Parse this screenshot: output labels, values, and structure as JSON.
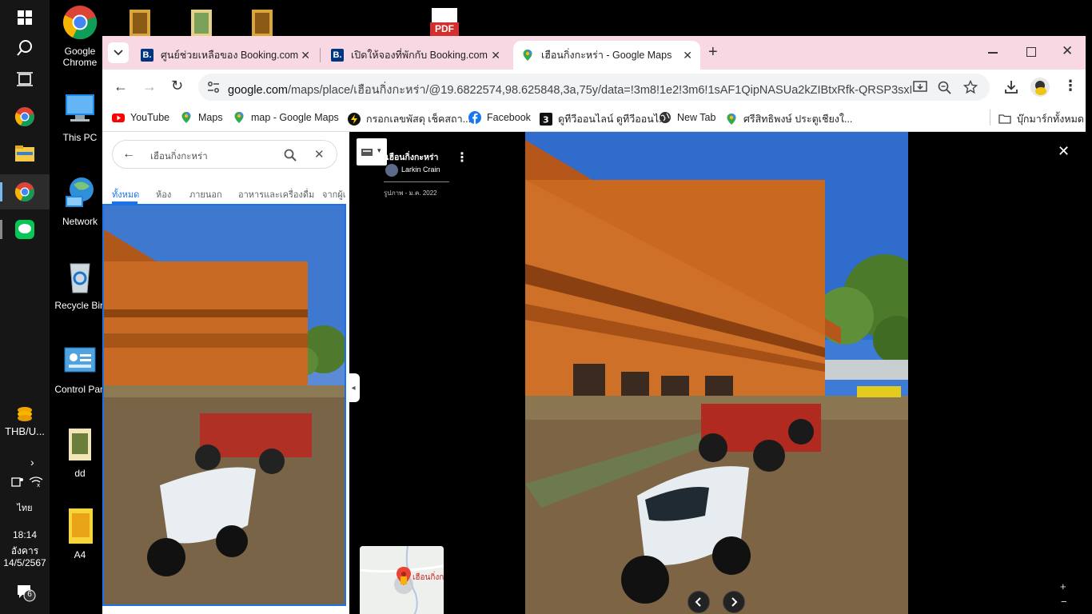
{
  "taskbar": {
    "currency_label": "THB/U...",
    "language": "ไทย",
    "time": "18:14",
    "day": "อังคาร",
    "date": "14/5/2567",
    "notification_count": "6"
  },
  "desktop": {
    "icons": [
      {
        "label": "Google Chrome"
      },
      {
        "label": "This PC"
      },
      {
        "label": "Network"
      },
      {
        "label": "Recycle Bin"
      },
      {
        "label": "Control Pan"
      },
      {
        "label": "dd"
      },
      {
        "label": "A4"
      }
    ],
    "pdf_label": "PDF"
  },
  "browser": {
    "tabs": [
      {
        "title": "ศูนย์ช่วยเหลือของ Booking.com",
        "favicon": "B."
      },
      {
        "title": "เปิดให้จองที่พักกับ Booking.com",
        "favicon": "B."
      },
      {
        "title": "เฮือนกิ่งกะหร่า - Google Maps",
        "favicon": "maps-pin"
      }
    ],
    "url_host": "google.com",
    "url_path": "/maps/place/เฮือนกิ่งกะหร่า/@19.6822574,98.625848,3a,75y/data=!3m8!1e2!3m6!1sAF1QipNASUa2kZIBtxRfk-QRSP3sxFptT3uc...",
    "bookmarks": [
      {
        "label": "YouTube",
        "icon": "youtube-icon"
      },
      {
        "label": "Maps",
        "icon": "maps-pin-icon"
      },
      {
        "label": "map - Google Maps",
        "icon": "maps-pin-icon"
      },
      {
        "label": "กรอกเลขพัสดุ เช็คสถา...",
        "icon": "bolt-icon"
      },
      {
        "label": "Facebook",
        "icon": "facebook-icon"
      },
      {
        "label": "ดูทีวีออนไลน์ ดูทีวีออนไ...",
        "icon": "three-icon"
      },
      {
        "label": "New Tab",
        "icon": "globe-icon"
      },
      {
        "label": "ศรีสิทธิพงษ์ ประตูเชียงใ...",
        "icon": "maps-pin-icon"
      }
    ],
    "all_bookmarks_label": "บุ๊กมาร์กทั้งหมด"
  },
  "maps": {
    "search_value": "เฮือนกิ่งกะหร่า",
    "categories": [
      "ทั้งหมด",
      "ห้อง",
      "ภายนอก",
      "อาหารและเครื่องดื่ม",
      "จากผู้เ"
    ],
    "place_title": "เฮือนกิ่งกะหร่า",
    "contributor": "Larkin Crain",
    "photo_date": "รูปภาพ - ม.ค. 2022",
    "minimap_label": "เฮือนกิ่งก"
  },
  "colors": {
    "tabstrip": "#f8d9e3",
    "accent_blue": "#1a73e8",
    "taskbar": "#161616"
  }
}
